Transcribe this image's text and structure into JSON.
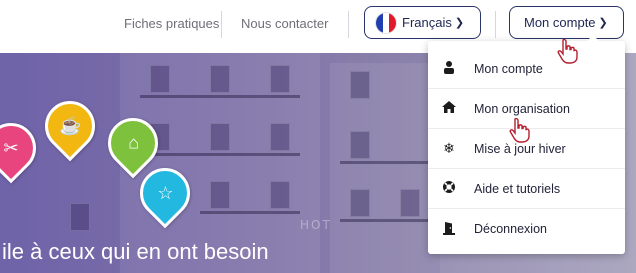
{
  "header": {
    "links": [
      "Fiches pratiques",
      "Nous contacter"
    ],
    "language_label": "Français",
    "account_label": "Mon compte"
  },
  "account_menu": {
    "items": [
      {
        "label": "Mon compte",
        "icon": "user-icon"
      },
      {
        "label": "Mon organisation",
        "icon": "home-icon"
      },
      {
        "label": "Mise à jour hiver",
        "icon": "snowflake-icon"
      },
      {
        "label": "Aide et tutoriels",
        "icon": "lifebuoy-icon"
      },
      {
        "label": "Déconnexion",
        "icon": "logout-door-icon"
      }
    ]
  },
  "hero": {
    "title": "ile à ceux qui en ont besoin",
    "sign": "HOT"
  },
  "colors": {
    "navy": "#1e2752",
    "pin_pink": "#e8457f",
    "pin_yellow": "#f2b711",
    "pin_green": "#7dc13d",
    "pin_cyan": "#22b8e0"
  }
}
